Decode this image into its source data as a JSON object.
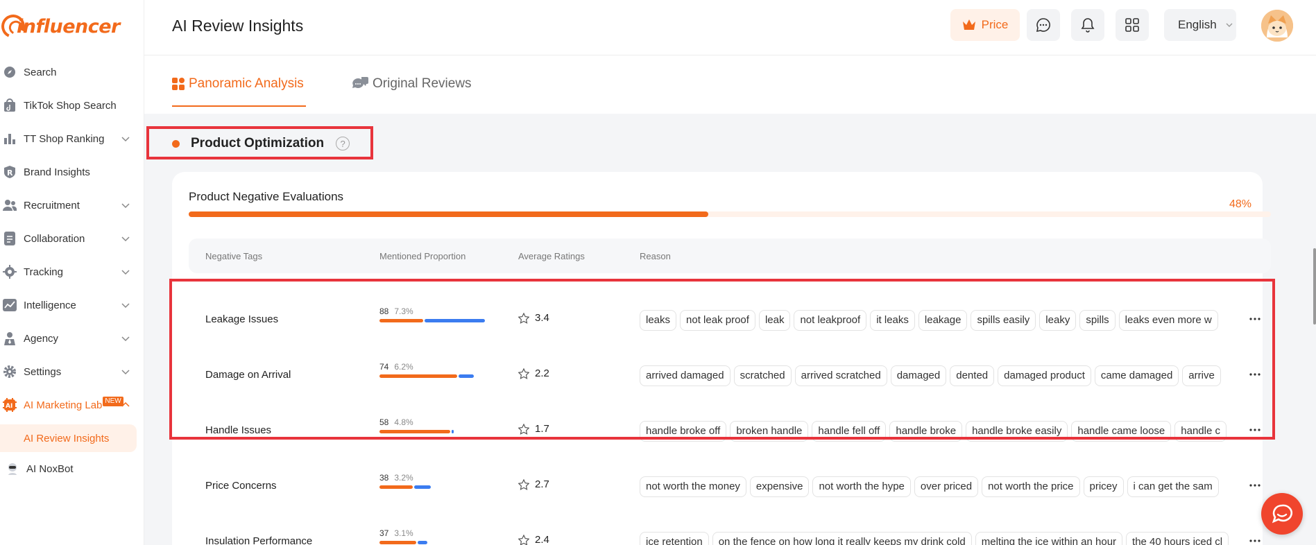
{
  "app": {
    "logo_text": "influencer"
  },
  "sidebar": {
    "items": [
      {
        "label": "Search",
        "icon": "compass-icon"
      },
      {
        "label": "TikTok Shop Search",
        "icon": "shop-bag-icon"
      },
      {
        "label": "TT Shop Ranking",
        "icon": "bar-chart-icon"
      },
      {
        "label": "Brand Insights",
        "icon": "brand-r-icon"
      },
      {
        "label": "Recruitment",
        "icon": "users-icon"
      },
      {
        "label": "Collaboration",
        "icon": "document-icon"
      },
      {
        "label": "Tracking",
        "icon": "target-icon"
      },
      {
        "label": "Intelligence",
        "icon": "trend-icon"
      },
      {
        "label": "Agency",
        "icon": "agent-icon"
      },
      {
        "label": "Settings",
        "icon": "gear-icon"
      },
      {
        "label": "AI Marketing Lab",
        "icon": "ai-icon",
        "badge": "NEW"
      }
    ],
    "sub_item": "AI Review Insights",
    "bottom_item": "AI NoxBot"
  },
  "header": {
    "title": "AI Review Insights",
    "price_label": "Price",
    "language": "English"
  },
  "tabs": [
    {
      "label": "Panoramic Analysis",
      "active": true
    },
    {
      "label": "Original Reviews",
      "active": false
    }
  ],
  "section": {
    "title": "Product Optimization",
    "help_glyph": "?"
  },
  "card": {
    "title": "Product Negative Evaluations",
    "percent_label": "48%",
    "progress": 0.48,
    "columns": [
      "Negative Tags",
      "Mentioned Proportion",
      "Average Ratings",
      "Reason"
    ],
    "rows": [
      {
        "name": "Leakage Issues",
        "count": "88",
        "proportion": "7.3%",
        "orange": 0.37,
        "blue": 0.51,
        "rating": "3.4",
        "tags": [
          "leaks",
          "not leak proof",
          "leak",
          "not leakproof",
          "it leaks",
          "leakage",
          "spills easily",
          "leaky",
          "spills",
          "leaks even more w"
        ]
      },
      {
        "name": "Damage on Arrival",
        "count": "74",
        "proportion": "6.2%",
        "orange": 0.66,
        "blue": 0.13,
        "rating": "2.2",
        "tags": [
          "arrived damaged",
          "scratched",
          "arrived scratched",
          "damaged",
          "dented",
          "damaged product",
          "came damaged",
          "arrive"
        ]
      },
      {
        "name": "Handle Issues",
        "count": "58",
        "proportion": "4.8%",
        "orange": 0.6,
        "blue": 0.02,
        "rating": "1.7",
        "tags": [
          "handle broke off",
          "broken handle",
          "handle fell off",
          "handle broke",
          "handle broke easily",
          "handle came loose",
          "handle c"
        ]
      },
      {
        "name": "Price Concerns",
        "count": "38",
        "proportion": "3.2%",
        "orange": 0.28,
        "blue": 0.14,
        "rating": "2.7",
        "tags": [
          "not worth the money",
          "expensive",
          "not worth the hype",
          "over priced",
          "not worth the price",
          "pricey",
          "i can get the sam"
        ]
      },
      {
        "name": "Insulation Performance",
        "count": "37",
        "proportion": "3.1%",
        "orange": 0.31,
        "blue": 0.08,
        "rating": "2.4",
        "tags": [
          "ice retention",
          "on the fence on how long it really keeps my drink cold",
          "melting the ice within an hour",
          "the 40 hours iced cl"
        ]
      }
    ]
  },
  "colors": {
    "accent": "#f26a1b",
    "blue": "#3b7cf0",
    "highlight": "#e8343c"
  }
}
